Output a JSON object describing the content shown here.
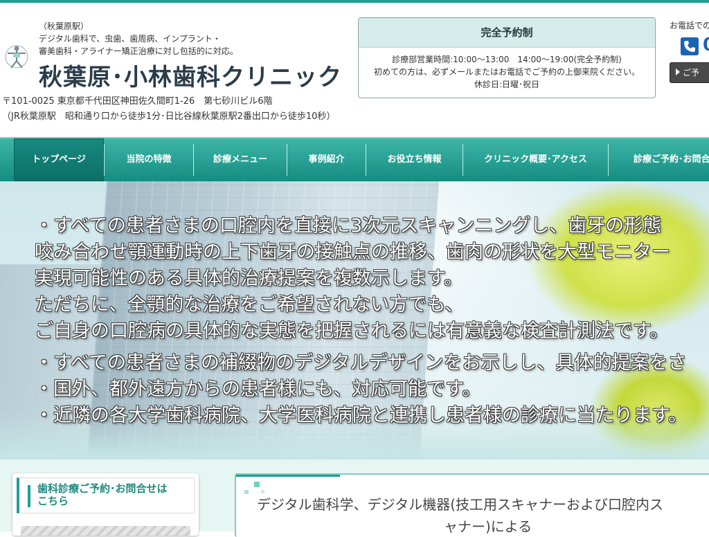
{
  "header": {
    "tagline": [
      "（秋葉原駅）",
      "デジタル歯科で、虫歯、歯周病、インプラント・",
      "審美歯科・アライナー矯正治療に対し包括的に対応。"
    ],
    "clinic_name": "秋葉原･小林歯科クリニック",
    "address_lines": [
      "〒101-0025 東京都千代田区神田佐久間町1-26　第七砂川ビル6階",
      "（JR秋葉原駅　昭和通り口から徒歩1分･日比谷線秋葉原駅2番出口から徒歩10秒）"
    ]
  },
  "reservation": {
    "title": "完全予約制",
    "lines": [
      "診療部営業時間:10:00～13:00　14:00～19:00(完全予約制)",
      "初めての方は、必ずメールまたはお電話でご予約の上御来院ください。",
      "休診日:日曜･祝日"
    ]
  },
  "contact": {
    "tel_label": "お電話での",
    "phone_partial": "0",
    "button_label": "ご予"
  },
  "nav": {
    "items": [
      {
        "label": "トップページ"
      },
      {
        "label": "当院の特徴"
      },
      {
        "label": "診療メニュー"
      },
      {
        "label": "事例紹介"
      },
      {
        "label": "お役立ち情報"
      },
      {
        "label": "クリニック概要･アクセス"
      },
      {
        "label": "診療ご予約･お問合"
      }
    ]
  },
  "hero": {
    "lines": [
      "・すべての患者さまの口腔内を直接に3次元スキャンニングし、歯牙の形態",
      "咬み合わせ顎運動時の上下歯牙の接触点の推移、歯肉の形状を大型モニター",
      "実現可能性のある具体的治療提案を複数示します。",
      "ただちに、全顎的な治療をご希望されない方でも、",
      "ご自身の口腔病の具体的な実態を把握されるには有意義な検査計測法です。",
      "・すべての患者さまの補綴物のデジタルデザインをお示しし、具体的提案をさ",
      "・国外、都外遠方からの患者様にも、対応可能です。",
      "・近隣の各大学歯科病院、大学医科病院と連携し患者様の診療に当たります。"
    ]
  },
  "sidebar": {
    "title_line1": "歯科診療ご予約･お問合せは",
    "title_line2": "こちら"
  },
  "main": {
    "heading_line1": "デジタル歯科学、デジタル機器(技工用スキャナーおよび口腔内ス",
    "heading_line2": "ャナー)による"
  }
}
